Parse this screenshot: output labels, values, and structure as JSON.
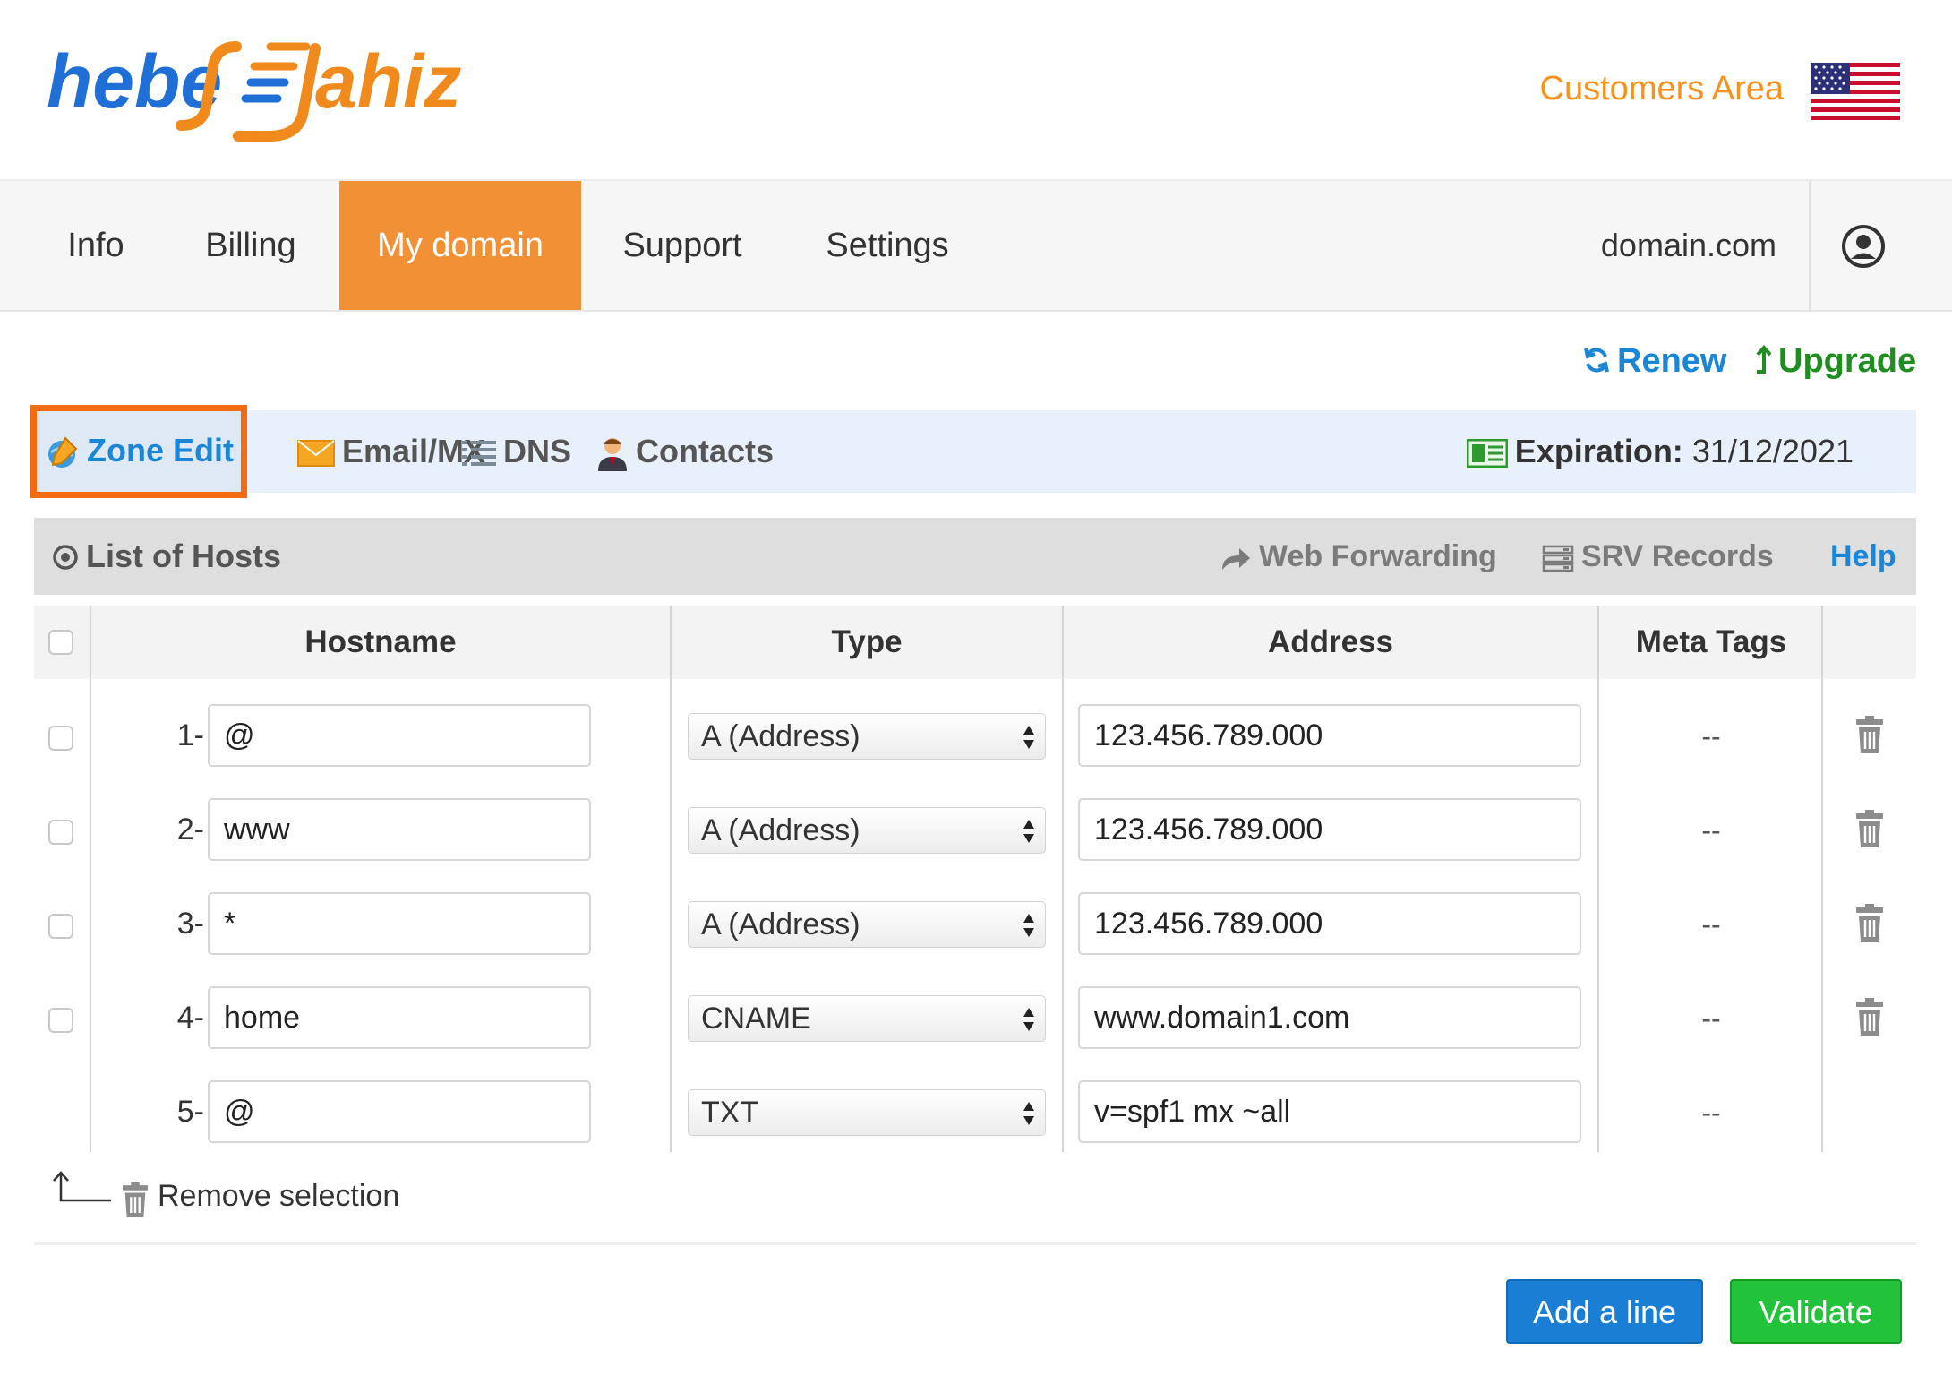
{
  "brand": {
    "logo_text": "hebergtahiz"
  },
  "header": {
    "customers_area": "Customers Area",
    "language_flag": "us-flag-icon"
  },
  "nav": {
    "items": [
      {
        "label": "Info"
      },
      {
        "label": "Billing"
      },
      {
        "label": "My domain",
        "active": true
      },
      {
        "label": "Support"
      },
      {
        "label": "Settings"
      }
    ],
    "domain": "domain.com",
    "user_icon": "user-circle-icon"
  },
  "actions": {
    "renew": "Renew",
    "upgrade": "Upgrade"
  },
  "subnav": {
    "items": [
      {
        "label": "Zone Edit",
        "icon": "zone-edit-icon",
        "active": true
      },
      {
        "label": "Email/MX",
        "icon": "envelope-icon"
      },
      {
        "label": "DNS",
        "icon": "list-icon"
      },
      {
        "label": "Contacts",
        "icon": "contact-person-icon"
      }
    ],
    "expiration_label": "Expiration:",
    "expiration_date": "31/12/2021"
  },
  "hosts_bar": {
    "title": "List of Hosts",
    "web_forwarding": "Web Forwarding",
    "srv_records": "SRV Records",
    "help": "Help"
  },
  "table": {
    "headers": {
      "hostname": "Hostname",
      "type": "Type",
      "address": "Address",
      "meta_tags": "Meta Tags"
    },
    "rows": [
      {
        "num": "1-",
        "hostname": "@",
        "type": "A (Address)",
        "address": "123.456.789.000",
        "meta": "--",
        "deletable": true
      },
      {
        "num": "2-",
        "hostname": "www",
        "type": "A (Address)",
        "address": "123.456.789.000",
        "meta": "--",
        "deletable": true
      },
      {
        "num": "3-",
        "hostname": "*",
        "type": "A (Address)",
        "address": "123.456.789.000",
        "meta": "--",
        "deletable": true
      },
      {
        "num": "4-",
        "hostname": "home",
        "type": "CNAME",
        "address": "www.domain1.com",
        "meta": "--",
        "deletable": true
      },
      {
        "num": "5-",
        "hostname": "@",
        "type": "TXT",
        "address": "v=spf1 mx ~all",
        "meta": "--",
        "deletable": false
      }
    ]
  },
  "remove_selection": "Remove selection",
  "buttons": {
    "add_line": "Add a line",
    "validate": "Validate"
  },
  "colors": {
    "accent_orange": "#f29035",
    "link_blue": "#1a86d8",
    "upgrade_green": "#1f8d1f",
    "validate_green": "#22c33a",
    "add_blue": "#1a7fd4"
  }
}
